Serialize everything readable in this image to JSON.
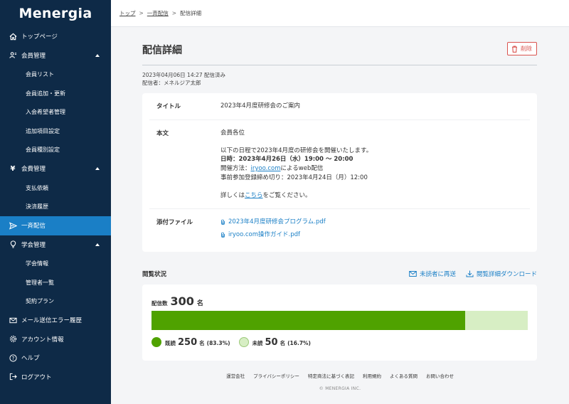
{
  "app": {
    "logo": "Menergia"
  },
  "sidebar": {
    "items": [
      {
        "label": "トップページ",
        "type": "main"
      },
      {
        "label": "会員管理",
        "type": "group"
      },
      {
        "label": "会員リスト",
        "type": "sub"
      },
      {
        "label": "会員追加・更新",
        "type": "sub"
      },
      {
        "label": "入会希望者管理",
        "type": "sub"
      },
      {
        "label": "追加項目設定",
        "type": "sub"
      },
      {
        "label": "会員種別設定",
        "type": "sub"
      },
      {
        "label": "会費管理",
        "type": "group"
      },
      {
        "label": "支払依頼",
        "type": "sub"
      },
      {
        "label": "決済履歴",
        "type": "sub"
      },
      {
        "label": "一斉配信",
        "type": "main",
        "active": true
      },
      {
        "label": "学会管理",
        "type": "group"
      },
      {
        "label": "学会情報",
        "type": "sub"
      },
      {
        "label": "管理者一覧",
        "type": "sub"
      },
      {
        "label": "契約プラン",
        "type": "sub"
      },
      {
        "label": "メール送信エラー履歴",
        "type": "main"
      },
      {
        "label": "アカウント情報",
        "type": "main"
      },
      {
        "label": "ヘルプ",
        "type": "main"
      },
      {
        "label": "ログアウト",
        "type": "main"
      }
    ]
  },
  "breadcrumb": {
    "top": "トップ",
    "broadcast": "一斉配信",
    "current": "配信詳細",
    "sep": ">"
  },
  "page": {
    "title": "配信詳細",
    "delete_label": "削除",
    "sent_info": "2023年04月06日 14:27 配信済み",
    "sender": "配信者：メネルジア太郎"
  },
  "detail": {
    "title_label": "タイトル",
    "title_value": "2023年4月度研修会のご案内",
    "body_label": "本文",
    "body": {
      "greeting": "会員各位",
      "line1": "以下の日程で2023年4月度の研修会を開催いたします。",
      "date_line": "日時：2023年4月26日（水）19:00 〜 20:00",
      "method_prefix": "開催方法：",
      "method_link": "iryoo.com",
      "method_suffix": "によるweb配信",
      "deadline": "事前参加登録締め切り：2023年4月24日（月）12:00",
      "more_prefix": "詳しくは",
      "more_link": "こちら",
      "more_suffix": "をご覧ください。"
    },
    "attach_label": "添付ファイル",
    "attachments": [
      "2023年4月度研修会プログラム.pdf",
      "iryoo.com操作ガイド.pdf"
    ]
  },
  "status": {
    "title": "閲覧状況",
    "resend_label": "未読者に再送",
    "download_label": "閲覧詳細ダウンロード",
    "total_label": "配信数",
    "total": "300",
    "unit": "名",
    "read_label": "既読",
    "read_count": "250",
    "read_pct": "(83.3%)",
    "read_fraction": 0.833,
    "unread_label": "未読",
    "unread_count": "50",
    "unread_pct": "(16.7%)",
    "read_color": "#4fa200",
    "unread_color": "#d7eec4"
  },
  "footer": {
    "links": [
      "運営会社",
      "プライバシーポリシー",
      "特定商法に基づく表記",
      "利用規約",
      "よくある質問",
      "お問い合わせ"
    ],
    "copyright": "© MENERGIA INC."
  }
}
